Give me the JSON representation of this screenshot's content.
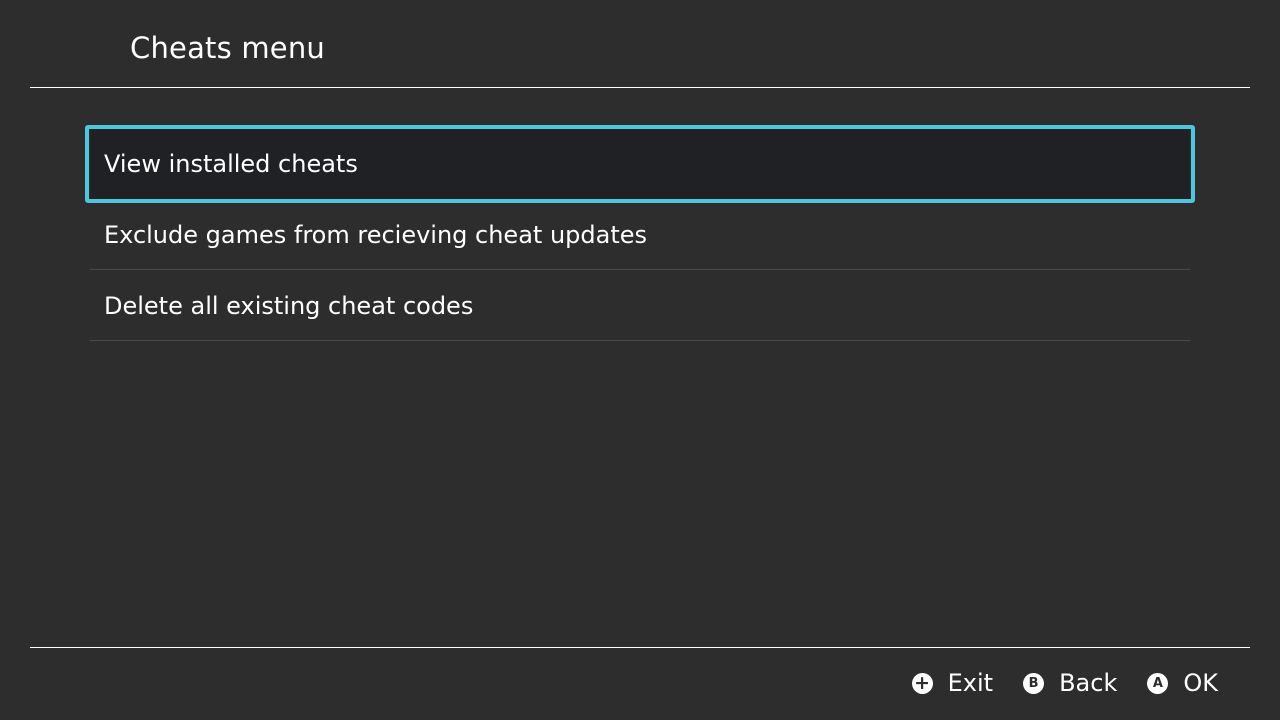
{
  "header": {
    "title": "Cheats menu"
  },
  "menu": {
    "items": [
      {
        "label": "View installed cheats",
        "selected": true
      },
      {
        "label": "Exclude games from recieving cheat updates",
        "selected": false
      },
      {
        "label": "Delete all existing cheat codes",
        "selected": false
      }
    ]
  },
  "footer": {
    "hints": [
      {
        "glyph": "+",
        "icon": "plus-button-icon",
        "label": "Exit"
      },
      {
        "glyph": "B",
        "icon": "b-button-icon",
        "label": "Back"
      },
      {
        "glyph": "A",
        "icon": "a-button-icon",
        "label": "OK"
      }
    ]
  },
  "colors": {
    "background": "#2d2d2d",
    "selection_border": "#4fc5e0",
    "selection_fill": "#1f2125"
  }
}
